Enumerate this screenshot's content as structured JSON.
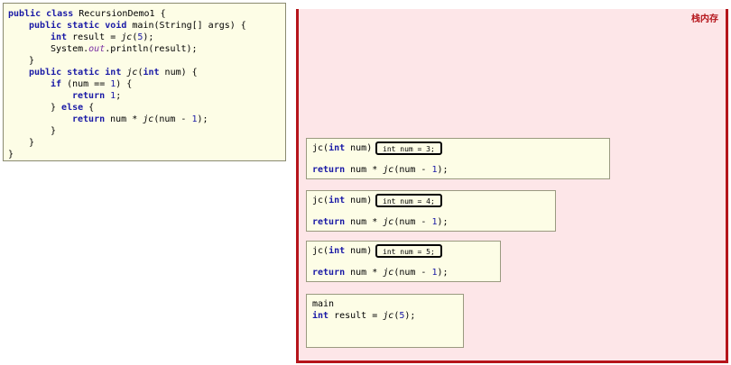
{
  "code": {
    "l1": {
      "kw": "public class",
      "rest": " RecursionDemo1 {"
    },
    "l2": {
      "kw": "public static void",
      "rest": " main(String[] args) {"
    },
    "l3": {
      "kw": "int",
      "a": " result = ",
      "call": "jc",
      "b": "(",
      "n": "5",
      "c": ");"
    },
    "l4": {
      "a": "System.",
      "out": "out",
      "b": ".println(result);"
    },
    "l5": "}",
    "l6": {
      "kw": "public static int",
      "a": " ",
      "call": "jc",
      "b": "(",
      "kw2": "int",
      "c": " num) {"
    },
    "l7": {
      "kw": "if",
      "a": " (num == ",
      "n": "1",
      "b": ") {"
    },
    "l8": {
      "kw": "return",
      "a": " ",
      "n": "1",
      "b": ";"
    },
    "l9": {
      "a": "} ",
      "kw": "else",
      "b": " {"
    },
    "l10": {
      "kw": "return",
      "a": " num * ",
      "call": "jc",
      "b": "(num - ",
      "n": "1",
      "c": ");"
    },
    "l11": "}",
    "l12": "}",
    "l13": "}"
  },
  "stack": {
    "title": "栈内存",
    "frames": [
      {
        "sig_a": "jc(",
        "sig_kw": "int",
        "sig_b": " num)",
        "var": "int num = 3;",
        "ret_kw": "return",
        "ret_a": " num * ",
        "ret_call": "jc",
        "ret_b": "(num - ",
        "ret_n": "1",
        "ret_c": ");"
      },
      {
        "sig_a": "jc(",
        "sig_kw": "int",
        "sig_b": " num)",
        "var": "int num = 4;",
        "ret_kw": "return",
        "ret_a": " num * ",
        "ret_call": "jc",
        "ret_b": "(num - ",
        "ret_n": "1",
        "ret_c": ");"
      },
      {
        "sig_a": "jc(",
        "sig_kw": "int",
        "sig_b": " num)",
        "var": "int num = 5;",
        "ret_kw": "return",
        "ret_a": " num * ",
        "ret_call": "jc",
        "ret_b": "(num - ",
        "ret_n": "1",
        "ret_c": ");"
      }
    ],
    "main": {
      "label": "main",
      "kw": "int",
      "a": " result = ",
      "call": "jc",
      "b": "(",
      "n": "5",
      "c": ");"
    }
  }
}
